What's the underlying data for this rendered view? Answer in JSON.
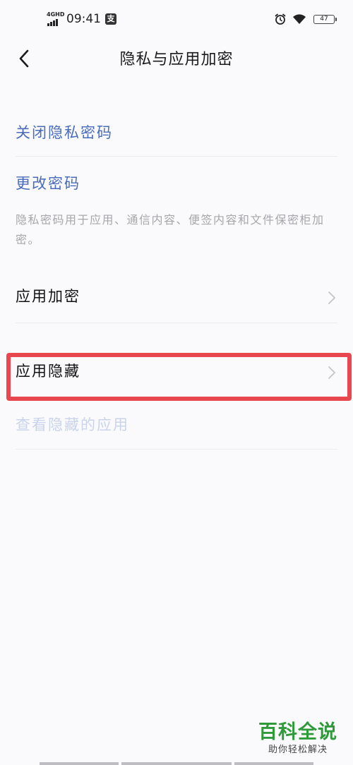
{
  "status_bar": {
    "network_label": "4GHD",
    "time": "09:41",
    "notification_icon_text": "支",
    "battery_level": "47"
  },
  "header": {
    "title": "隐私与应用加密"
  },
  "menu": {
    "close_privacy_password": "关闭隐私密码",
    "change_password": "更改密码",
    "note": "隐私密码用于应用、通信内容、便签内容和文件保密柜加密。",
    "app_encryption": "应用加密",
    "app_hiding": "应用隐藏",
    "view_hidden_apps": "查看隐藏的应用"
  },
  "watermark": {
    "main": "百科全说",
    "sub": "助你轻松解决"
  },
  "colors": {
    "link_blue": "#4a6cb8",
    "highlight_red": "#e8474f",
    "watermark_green": "#2f9a3a",
    "disabled_blue": "#c9d4ea"
  },
  "icons": {
    "back": "chevron-left-icon",
    "row_arrow": "chevron-right-icon",
    "alarm": "alarm-clock-icon",
    "wifi": "wifi-icon",
    "battery": "battery-icon",
    "signal": "signal-bars-icon"
  }
}
